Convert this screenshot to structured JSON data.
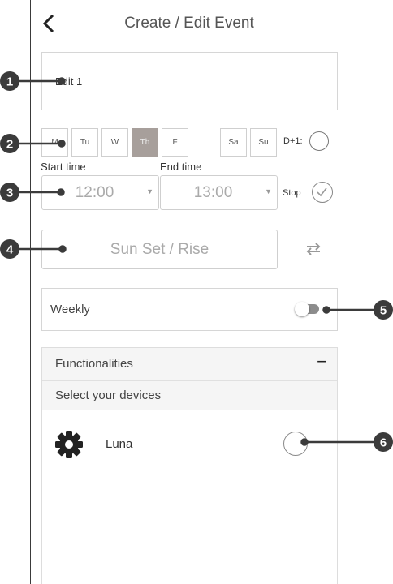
{
  "header": {
    "title": "Create / Edit Event",
    "back_icon": "chevron-left-icon"
  },
  "event": {
    "name": "Edit 1"
  },
  "days": [
    {
      "label": "M",
      "selected": false
    },
    {
      "label": "Tu",
      "selected": false
    },
    {
      "label": "W",
      "selected": false
    },
    {
      "label": "Th",
      "selected": true
    },
    {
      "label": "F",
      "selected": false
    },
    {
      "label": "Sa",
      "selected": false
    },
    {
      "label": "Su",
      "selected": false
    }
  ],
  "d_plus_one": {
    "label": "D+1:"
  },
  "start_time": {
    "label": "Start time",
    "value": "12:00"
  },
  "end_time": {
    "label": "End time",
    "value": "13:00"
  },
  "stop": {
    "label": "Stop"
  },
  "sun": {
    "label": "Sun Set / Rise",
    "swap_icon": "swap-arrows-icon"
  },
  "weekly": {
    "label": "Weekly",
    "toggle_on": false
  },
  "functionalities": {
    "title": "Functionalities",
    "collapse_symbol": "−",
    "select_label": "Select your devices",
    "devices": [
      {
        "name": "Luna",
        "icon": "gear-icon",
        "selected": false
      }
    ]
  },
  "callouts": [
    "1",
    "2",
    "3",
    "4",
    "5",
    "6"
  ],
  "colors": {
    "selected_day": "#a79f9b",
    "callout": "#3b3b3b"
  }
}
